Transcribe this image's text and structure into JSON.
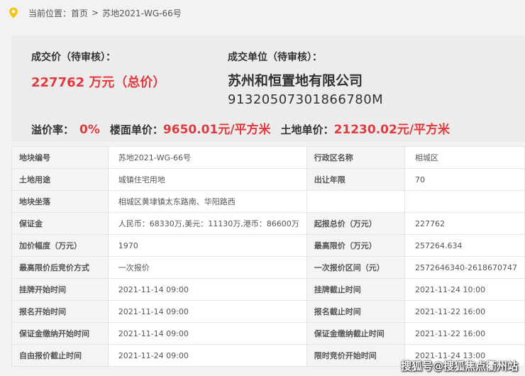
{
  "breadcrumb": {
    "prefix": "当前位置：",
    "home": "首页",
    "separator": ">",
    "current": "苏地2021-WG-66号"
  },
  "deal": {
    "price_label": "成交价（待审核）：",
    "price_value": "227762 万元（总价）",
    "unit_label": "成交单位（待审核）：",
    "company": "苏州和恒置地有限公司",
    "code": "91320507301866780M",
    "premium_label": "溢价率：",
    "premium_value": "0%",
    "floor_price_label": "楼面单价：",
    "floor_price_value": "9650.01元/平方米",
    "land_price_label": "土地单价：",
    "land_price_value": "21230.02元/平方米"
  },
  "table": {
    "rows": [
      [
        "地块编号",
        "苏地2021-WG-66号",
        "行政区名称",
        "相城区"
      ],
      [
        "土地用途",
        "城镇住宅用地",
        "出让年限",
        "70"
      ],
      [
        "地块坐落",
        "相城区黄埭镇太东路南、华阳路西",
        "",
        ""
      ],
      [
        "保证金",
        "人民币：68330万,美元：11130万,港币：86600万",
        "起报总价（万元）",
        "227762"
      ],
      [
        "加价幅度（万元）",
        "1970",
        "最高限价（万元）",
        "257264.634"
      ],
      [
        "最高限价后竞价方式",
        "一次报价",
        "一次报价区间（元）",
        "2572646340-2618670747"
      ],
      [
        "挂牌开始时间",
        "2021-11-14 09:00",
        "挂牌截止时间",
        "2021-11-24 10:00"
      ],
      [
        "报名开始时间",
        "2021-11-14 09:00",
        "报名截止时间",
        "2021-11-22 16:00"
      ],
      [
        "保证金缴纳开始时间",
        "2021-11-14 09:00",
        "保证金缴纳截止时间",
        "2021-11-22 16:00"
      ],
      [
        "自由报价截止时间",
        "2021-11-24 09:00",
        "限时竞价开始时间",
        "2021-11-24 13:00"
      ]
    ]
  },
  "watermark": "搜狐号@搜狐焦点衢州站",
  "colors": {
    "accent_red": "#e0393e",
    "pin_yellow": "#f5c518"
  },
  "icons": {
    "location": "location-pin-icon"
  }
}
